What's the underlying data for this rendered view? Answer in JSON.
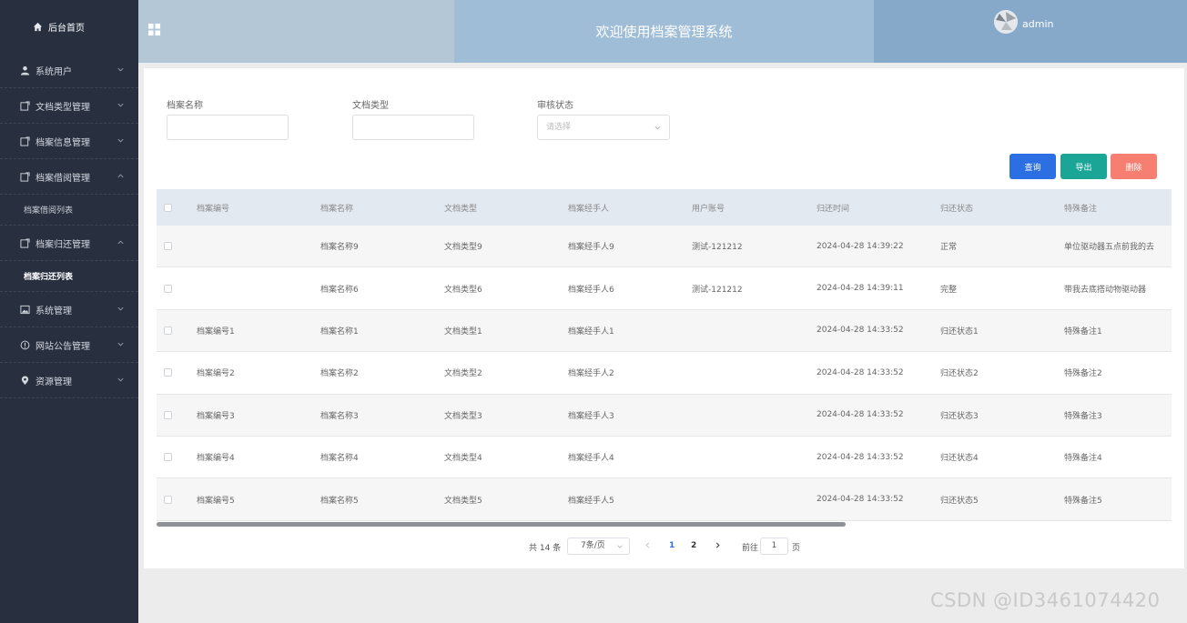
{
  "sidebar": {
    "home": "后台首页",
    "items": [
      {
        "label": "系统用户",
        "icon": "user-icon"
      },
      {
        "label": "文档类型管理",
        "icon": "doc-edit-icon"
      },
      {
        "label": "档案信息管理",
        "icon": "doc-edit-icon"
      },
      {
        "label": "档案借阅管理",
        "icon": "doc-edit-icon"
      },
      {
        "label": "档案归还管理",
        "icon": "doc-edit-icon"
      },
      {
        "label": "系统管理",
        "icon": "image-icon"
      },
      {
        "label": "网站公告管理",
        "icon": "info-circle-icon"
      },
      {
        "label": "资源管理",
        "icon": "location-pin-icon"
      }
    ],
    "sub_borrow": "档案借阅列表",
    "sub_return": "档案归还列表"
  },
  "header": {
    "title": "欢迎使用档案管理系统",
    "user": "admin"
  },
  "filters": {
    "name_label": "档案名称",
    "type_label": "文档类型",
    "status_label": "审核状态",
    "status_placeholder": "请选择"
  },
  "buttons": {
    "query": "查询",
    "export": "导出",
    "delete": "删除"
  },
  "colors": {
    "query": "#2b6fe2",
    "export": "#1aa596",
    "delete": "#f67f71"
  },
  "table": {
    "headers": [
      "档案编号",
      "档案名称",
      "文档类型",
      "档案经手人",
      "用户账号",
      "归还时间",
      "归还状态",
      "特殊备注"
    ],
    "rows": [
      [
        "",
        "档案名称9",
        "文档类型9",
        "档案经手人9",
        "测试-121212",
        "2024-04-28 14:39:22",
        "正常",
        "单位驱动器五点前我的去"
      ],
      [
        "",
        "档案名称6",
        "文档类型6",
        "档案经手人6",
        "测试-121212",
        "2024-04-28 14:39:11",
        "完整",
        "带我去底搭动物驱动器"
      ],
      [
        "档案编号1",
        "档案名称1",
        "文档类型1",
        "档案经手人1",
        "",
        "2024-04-28 14:33:52",
        "归还状态1",
        "特殊备注1"
      ],
      [
        "档案编号2",
        "档案名称2",
        "文档类型2",
        "档案经手人2",
        "",
        "2024-04-28 14:33:52",
        "归还状态2",
        "特殊备注2"
      ],
      [
        "档案编号3",
        "档案名称3",
        "文档类型3",
        "档案经手人3",
        "",
        "2024-04-28 14:33:52",
        "归还状态3",
        "特殊备注3"
      ],
      [
        "档案编号4",
        "档案名称4",
        "文档类型4",
        "档案经手人4",
        "",
        "2024-04-28 14:33:52",
        "归还状态4",
        "特殊备注4"
      ],
      [
        "档案编号5",
        "档案名称5",
        "文档类型5",
        "档案经手人5",
        "",
        "2024-04-28 14:33:52",
        "归还状态5",
        "特殊备注5"
      ]
    ]
  },
  "pagination": {
    "total": "共 14 条",
    "page_size": "7条/页",
    "pages": [
      "1",
      "2"
    ],
    "current": "1",
    "goto": "前往",
    "jump_value": "1",
    "page_word": "页"
  },
  "watermark": "CSDN @ID3461074420"
}
